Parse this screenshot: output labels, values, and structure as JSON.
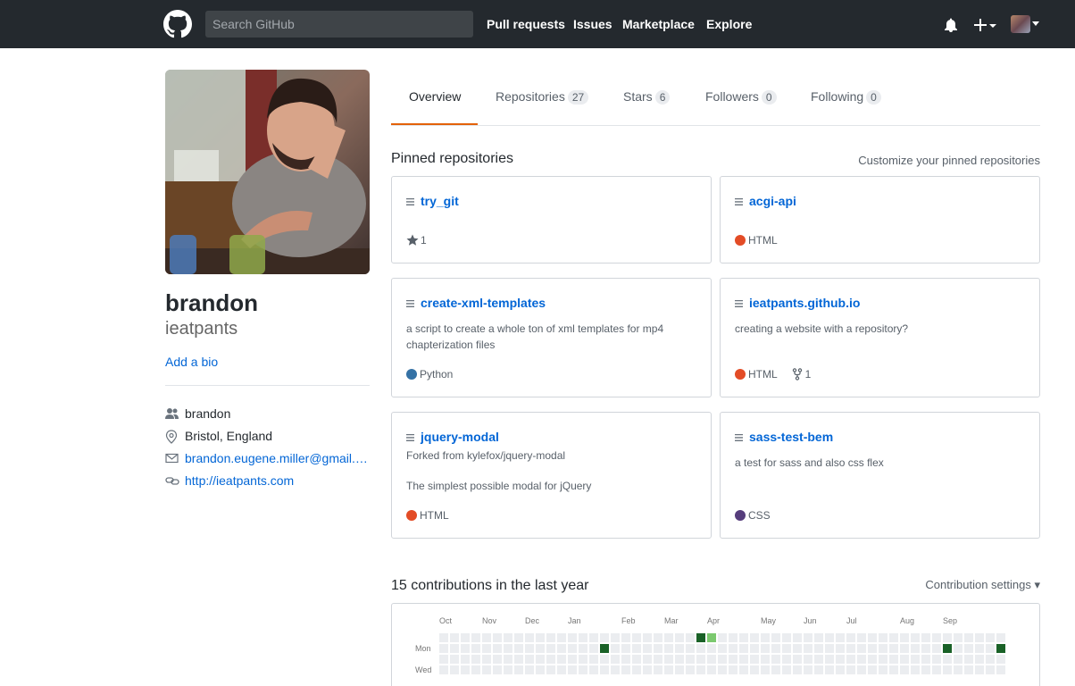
{
  "header": {
    "search_placeholder": "Search GitHub",
    "nav": [
      "Pull requests",
      "Issues",
      "Marketplace",
      "Explore"
    ]
  },
  "profile": {
    "fullname": "brandon",
    "username": "ieatpants",
    "add_bio": "Add a bio",
    "details": {
      "org": "brandon",
      "location": "Bristol, England",
      "email": "brandon.eugene.miller@gmail.com",
      "website": "http://ieatpants.com"
    }
  },
  "tabs": [
    {
      "label": "Overview",
      "count": ""
    },
    {
      "label": "Repositories",
      "count": "27"
    },
    {
      "label": "Stars",
      "count": "6"
    },
    {
      "label": "Followers",
      "count": "0"
    },
    {
      "label": "Following",
      "count": "0"
    }
  ],
  "pinned": {
    "title": "Pinned repositories",
    "customize": "Customize your pinned repositories",
    "repos": [
      {
        "name": "try_git",
        "fork": "",
        "desc": "",
        "lang": "",
        "lang_color": "",
        "stars": "1",
        "forks": ""
      },
      {
        "name": "acgi-api",
        "fork": "",
        "desc": "",
        "lang": "HTML",
        "lang_color": "#e34c26",
        "stars": "",
        "forks": ""
      },
      {
        "name": "create-xml-templates",
        "fork": "",
        "desc": "a script to create a whole ton of xml templates for mp4 chapterization files",
        "lang": "Python",
        "lang_color": "#3572A5",
        "stars": "",
        "forks": ""
      },
      {
        "name": "ieatpants.github.io",
        "fork": "",
        "desc": "creating a website with a repository?",
        "lang": "HTML",
        "lang_color": "#e34c26",
        "stars": "",
        "forks": "1"
      },
      {
        "name": "jquery-modal",
        "fork": "Forked from kylefox/jquery-modal",
        "desc": "The simplest possible modal for jQuery",
        "lang": "HTML",
        "lang_color": "#e34c26",
        "stars": "",
        "forks": ""
      },
      {
        "name": "sass-test-bem",
        "fork": "",
        "desc": "a test for sass and also css flex",
        "lang": "CSS",
        "lang_color": "#563d7c",
        "stars": "",
        "forks": ""
      }
    ]
  },
  "contributions": {
    "title": "15 contributions in the last year",
    "settings": "Contribution settings ▾",
    "months": [
      "Oct",
      "Nov",
      "Dec",
      "Jan",
      "Feb",
      "Mar",
      "Apr",
      "May",
      "Jun",
      "Jul",
      "Aug",
      "Sep"
    ],
    "days": [
      "Mon",
      "Wed"
    ],
    "colors": {
      "empty": "#ebedf0",
      "l1": "#7bc96f",
      "l4": "#196127"
    }
  }
}
